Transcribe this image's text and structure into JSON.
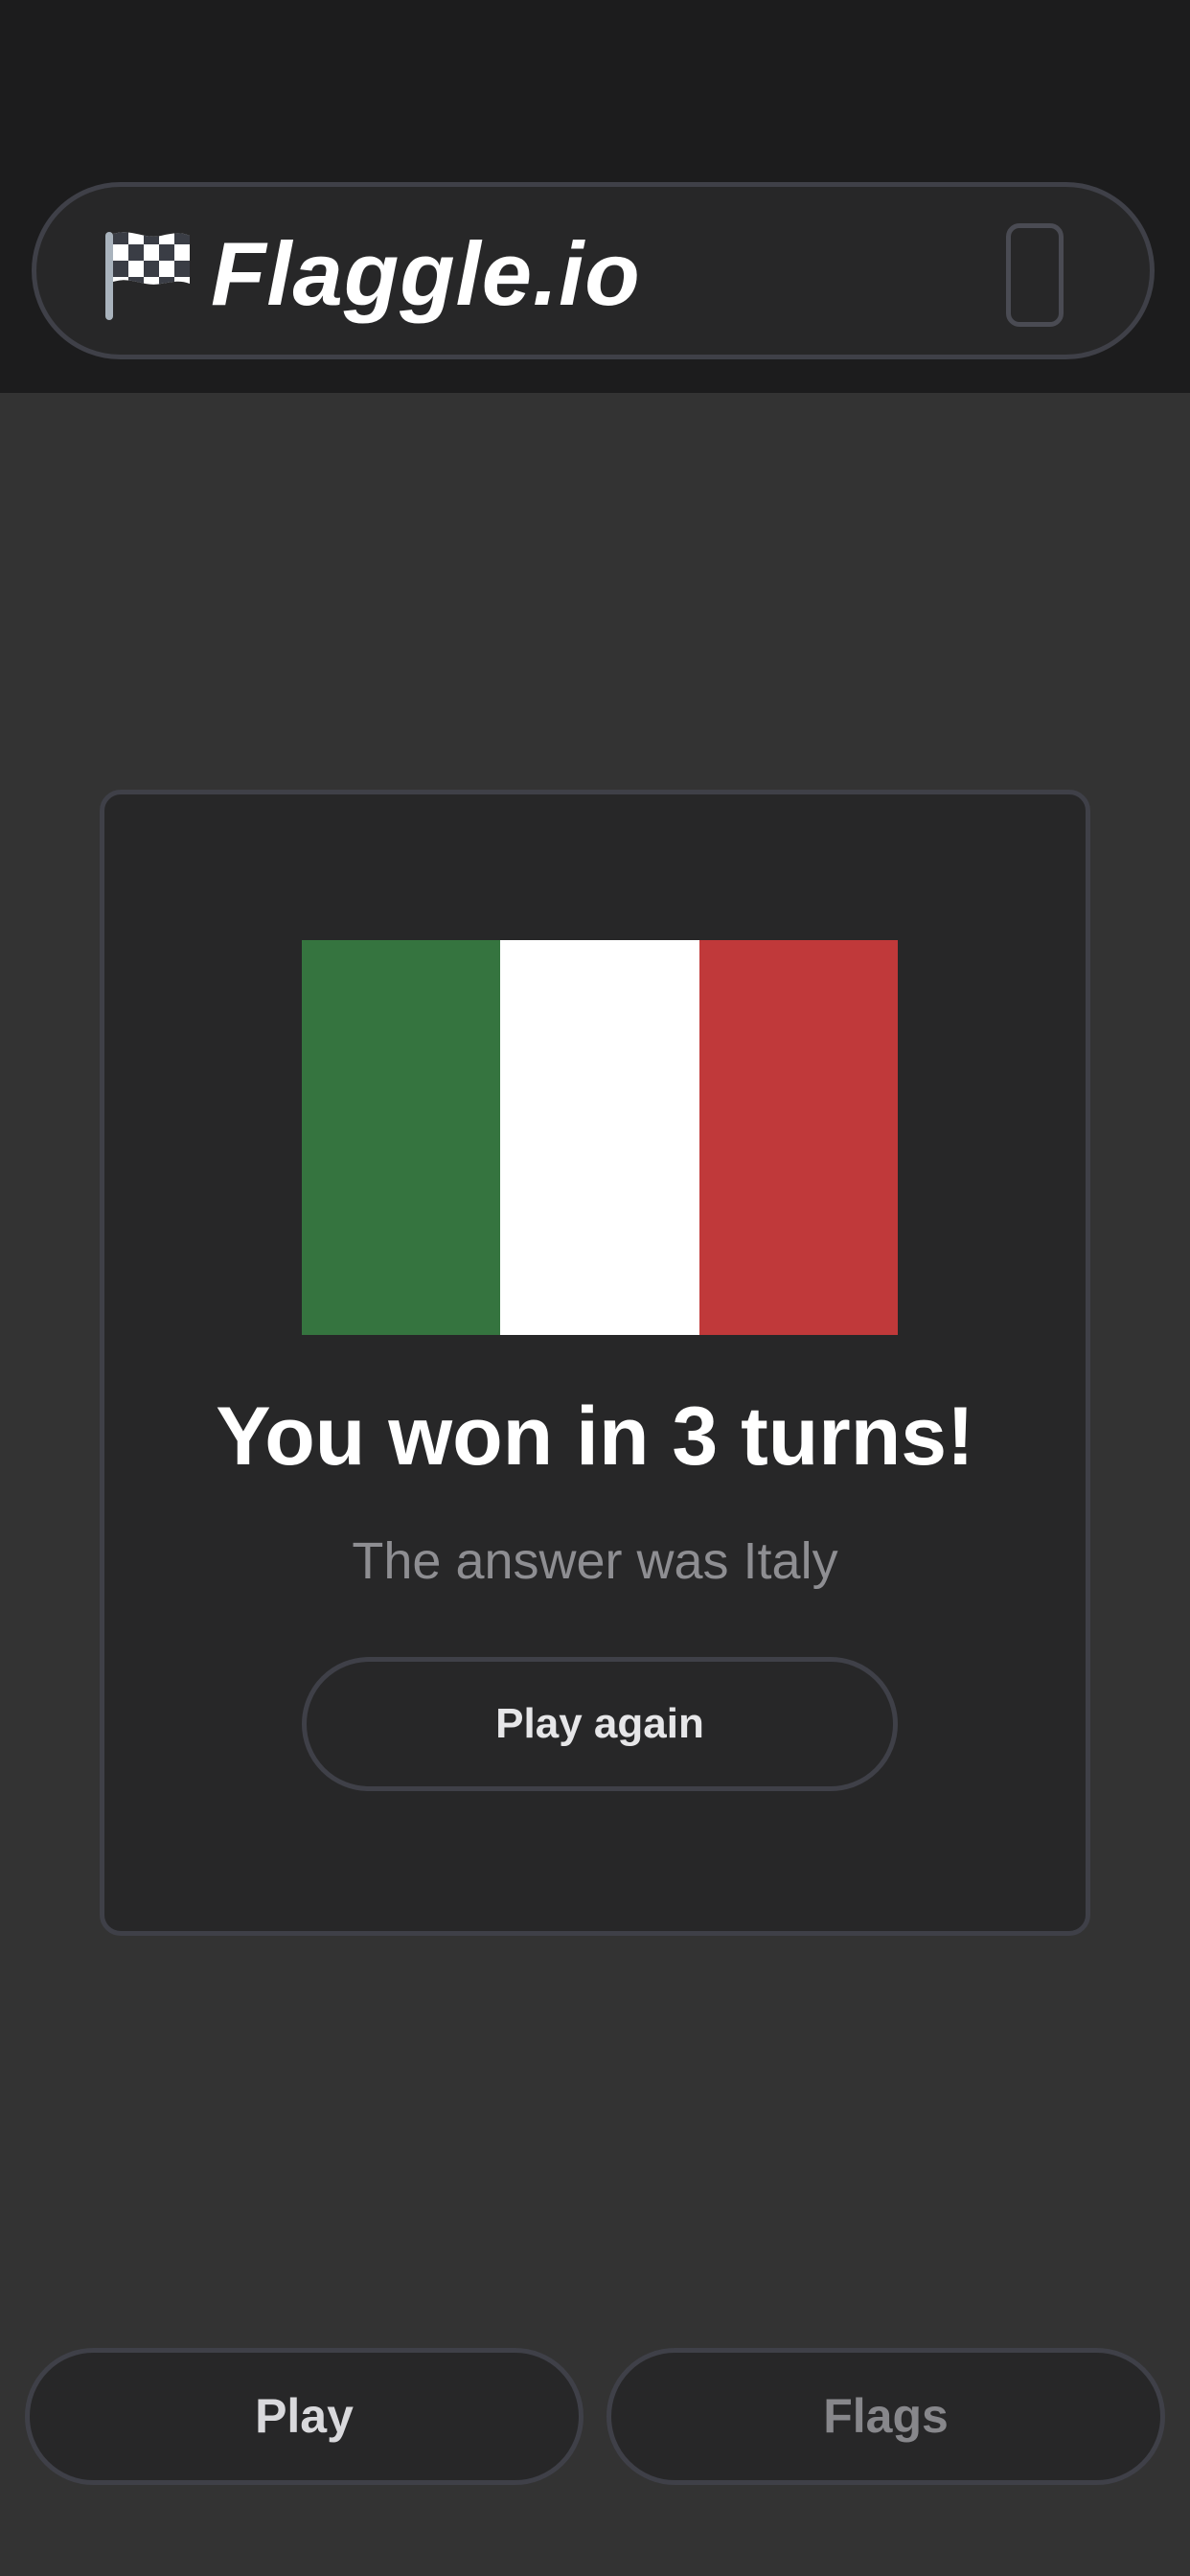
{
  "header": {
    "brand": "Flaggle.io",
    "logo_icon": "checkered-flag-icon",
    "device_icon": "phone-outline-icon"
  },
  "result": {
    "title": "You won in 3 turns!",
    "answer": "The answer was Italy",
    "play_again_label": "Play again",
    "flag_colors": [
      "#35743f",
      "#ffffff",
      "#c0393a"
    ]
  },
  "nav": {
    "play_label": "Play",
    "flags_label": "Flags"
  },
  "colors": {
    "background": "#333333",
    "top_bar": "#1c1c1d",
    "surface": "#272728",
    "border": "#3f4048"
  }
}
